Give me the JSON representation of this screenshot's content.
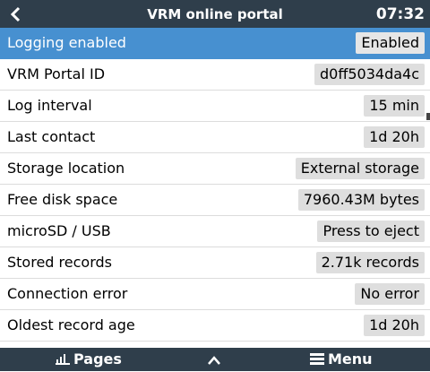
{
  "header": {
    "title": "VRM online portal",
    "time": "07:32"
  },
  "rows": [
    {
      "label": "Logging enabled",
      "value": "Enabled"
    },
    {
      "label": "VRM Portal ID",
      "value": "d0ff5034da4c"
    },
    {
      "label": "Log interval",
      "value": "15 min"
    },
    {
      "label": "Last contact",
      "value": "1d 20h"
    },
    {
      "label": "Storage location",
      "value": "External storage"
    },
    {
      "label": "Free disk space",
      "value": "7960.43M bytes"
    },
    {
      "label": "microSD / USB",
      "value": "Press to eject"
    },
    {
      "label": "Stored records",
      "value": "2.71k records"
    },
    {
      "label": "Connection error",
      "value": "No error"
    },
    {
      "label": "Oldest record age",
      "value": "1d 20h"
    }
  ],
  "footer": {
    "pages_label": "Pages",
    "menu_label": "Menu"
  },
  "colors": {
    "header_bg": "#2f3e4b",
    "selected_row": "#4790d0",
    "value_box": "#dedede"
  },
  "icons": {
    "back": "chevron-left-icon",
    "pages": "bar-chart-icon",
    "up": "chevron-up-icon",
    "menu": "hamburger-icon"
  }
}
